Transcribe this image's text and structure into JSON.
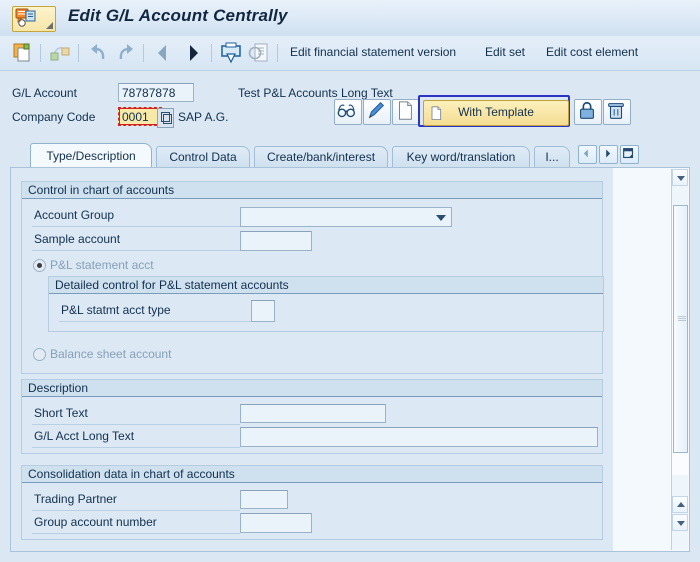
{
  "window": {
    "title": "Edit G/L Account Centrally",
    "app_icon": "sap-transaction-icon"
  },
  "toolbar": {
    "icons": [
      {
        "name": "new-object-icon",
        "enabled": true
      },
      {
        "name": "other-object-icon",
        "enabled": false
      },
      {
        "name": "undo-icon",
        "enabled": false
      },
      {
        "name": "redo-icon",
        "enabled": false
      },
      {
        "name": "back-arrow-icon",
        "enabled": false
      },
      {
        "name": "forward-arrow-icon",
        "enabled": true
      },
      {
        "name": "printer-icon",
        "enabled": true
      },
      {
        "name": "display-document-icon",
        "enabled": false
      }
    ],
    "links": [
      "Edit financial statement version",
      "Edit set",
      "Edit cost element"
    ]
  },
  "header": {
    "gl_account_label": "G/L Account",
    "gl_account_value": "78787878",
    "gl_account_desc": "Test P&L Accounts Long Text",
    "company_code_label": "Company Code",
    "company_code_value": "0001",
    "company_code_desc": "SAP A.G.",
    "matchcode_icon": "search-help-icon"
  },
  "actions": {
    "buttons": [
      {
        "name": "display-changes-button",
        "icon": "glasses-icon"
      },
      {
        "name": "change-button",
        "icon": "pencil-icon"
      },
      {
        "name": "create-button",
        "icon": "blank-document-icon"
      },
      {
        "name": "lock-button",
        "icon": "padlock-icon"
      },
      {
        "name": "delete-button",
        "icon": "trash-icon"
      }
    ],
    "with_template_label": "With Template",
    "with_template_icon": "document-icon",
    "focus_color": "#2b35c4"
  },
  "tabs": {
    "items": [
      {
        "label": "Type/Description",
        "active": true
      },
      {
        "label": "Control Data",
        "active": false
      },
      {
        "label": "Create/bank/interest",
        "active": false
      },
      {
        "label": "Key word/translation",
        "active": false
      },
      {
        "label": "I...",
        "active": false
      }
    ],
    "nav": {
      "prev_icon": "triangle-left-icon",
      "next_icon": "triangle-right-icon",
      "list_icon": "tab-list-icon"
    }
  },
  "form": {
    "groups": [
      {
        "name": "control-in-chart-of-accounts",
        "title": "Control in chart of accounts",
        "fields": [
          {
            "label": "Account Group",
            "value": "",
            "control": "dropdown"
          },
          {
            "label": "Sample account",
            "value": "",
            "control": "input"
          }
        ],
        "radios": [
          {
            "label": "P&L statement acct",
            "selected": true,
            "enabled": false
          },
          {
            "label": "Balance sheet account",
            "selected": false,
            "enabled": false
          }
        ],
        "sub": {
          "title": "Detailed control for P&L statement accounts",
          "fields": [
            {
              "label": "P&L statmt acct type",
              "value": "",
              "control": "input"
            }
          ]
        }
      },
      {
        "name": "description",
        "title": "Description",
        "fields": [
          {
            "label": "Short Text",
            "value": "",
            "control": "input"
          },
          {
            "label": "G/L Acct Long Text",
            "value": "",
            "control": "input"
          }
        ]
      },
      {
        "name": "consolidation-data-in-chart-of-accounts",
        "title": "Consolidation data in chart of accounts",
        "fields": [
          {
            "label": "Trading Partner",
            "value": "",
            "control": "input"
          },
          {
            "label": "Group account number",
            "value": "",
            "control": "input"
          }
        ]
      }
    ]
  },
  "scrollbar": {
    "up_icon": "scroll-up-icon",
    "down_icon": "scroll-down-icon"
  },
  "colors": {
    "background": "#dce9f5",
    "header_band": "#cfe0ef",
    "field_bg": "#eaf2fa",
    "focus_field_bg": "#f7e9a8",
    "focus_field_border": "#d3202a",
    "accent": "#12304d"
  }
}
